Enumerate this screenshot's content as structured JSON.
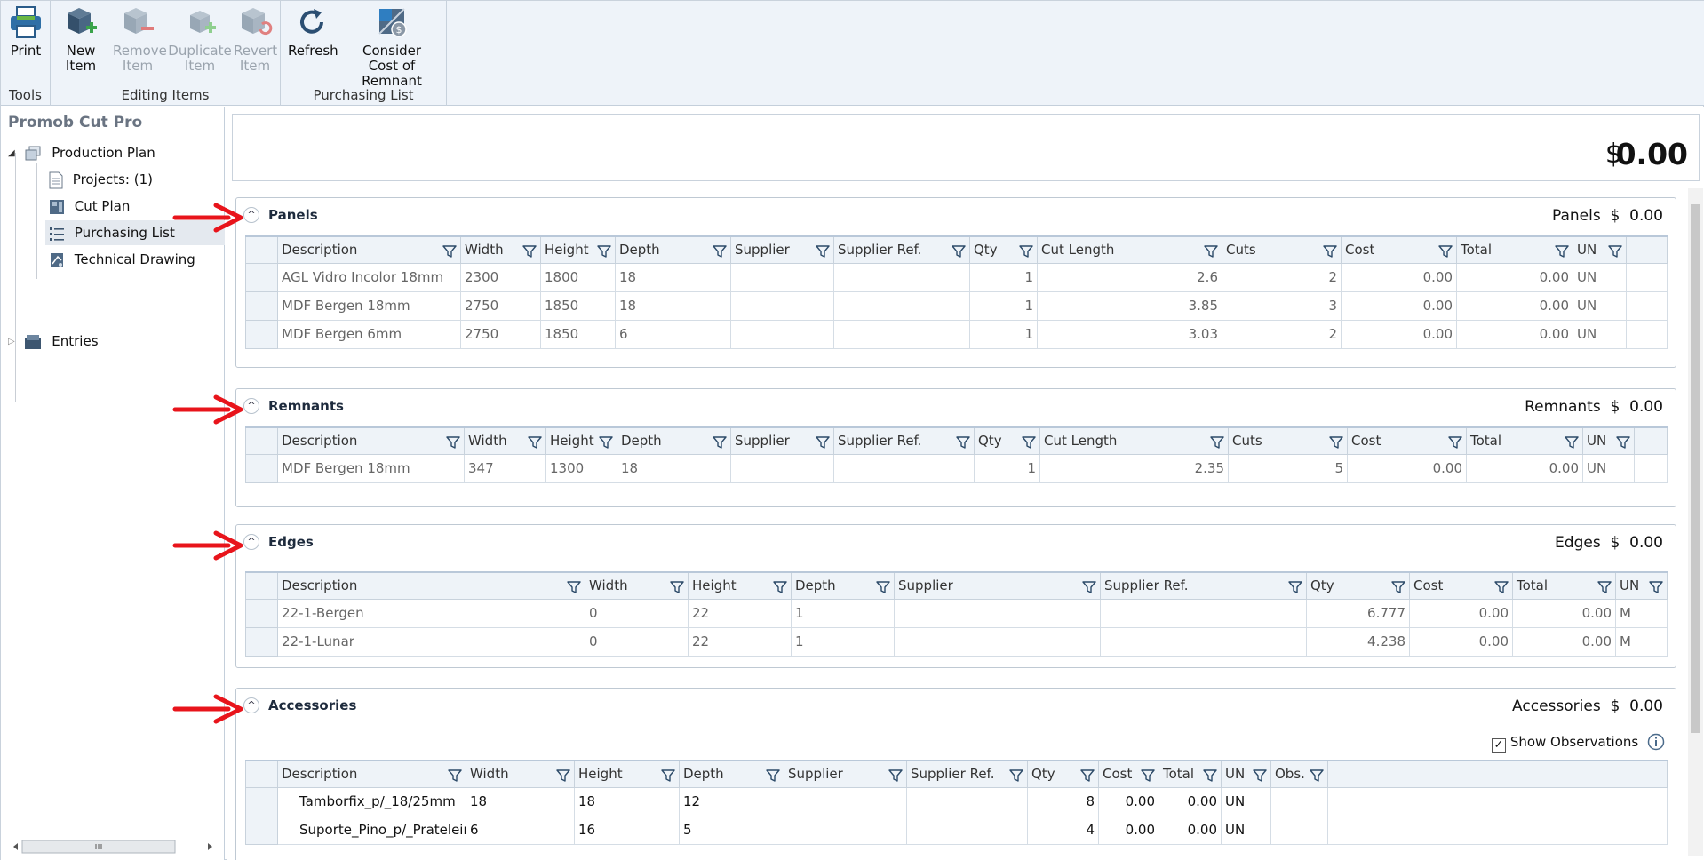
{
  "ribbon": {
    "groups": {
      "tools": "Tools",
      "editing": "Editing Items",
      "purchasing": "Purchasing List"
    },
    "buttons": {
      "print": "Print",
      "new_item": [
        "New",
        "Item"
      ],
      "remove_item": [
        "Remove",
        "Item"
      ],
      "duplicate_item": [
        "Duplicate",
        "Item"
      ],
      "revert_item": [
        "Revert",
        "Item"
      ],
      "refresh": "Refresh",
      "consider_cost": [
        "Consider",
        "Cost of Remnant"
      ]
    }
  },
  "side": {
    "title": "Promob Cut Pro",
    "tree": {
      "production_plan": "Production Plan",
      "projects": "Projects: (1)",
      "cut_plan": "Cut Plan",
      "purchasing_list": "Purchasing List",
      "technical_drawing": "Technical Drawing",
      "entries": "Entries"
    }
  },
  "total": {
    "currency": "$",
    "value": "0.00"
  },
  "panels": {
    "title": "Panels",
    "summary_label": "Panels",
    "summary_currency": "$",
    "summary_value": "0.00",
    "columns": [
      "Description",
      "Width",
      "Height",
      "Depth",
      "Supplier",
      "Supplier Ref.",
      "Qty",
      "Cut Length",
      "Cuts",
      "Cost",
      "Total",
      "UN"
    ],
    "rows": [
      [
        "AGL Vidro Incolor 18mm",
        "2300",
        "1800",
        "18",
        "",
        "",
        "1",
        "2.6",
        "2",
        "0.00",
        "0.00",
        "UN"
      ],
      [
        "MDF Bergen 18mm",
        "2750",
        "1850",
        "18",
        "",
        "",
        "1",
        "3.85",
        "3",
        "0.00",
        "0.00",
        "UN"
      ],
      [
        "MDF Bergen 6mm",
        "2750",
        "1850",
        "6",
        "",
        "",
        "1",
        "3.03",
        "2",
        "0.00",
        "0.00",
        "UN"
      ]
    ]
  },
  "remnants": {
    "title": "Remnants",
    "summary_label": "Remnants",
    "summary_currency": "$",
    "summary_value": "0.00",
    "columns": [
      "Description",
      "Width",
      "Height",
      "Depth",
      "Supplier",
      "Supplier Ref.",
      "Qty",
      "Cut Length",
      "Cuts",
      "Cost",
      "Total",
      "UN"
    ],
    "rows": [
      [
        "MDF Bergen 18mm",
        "347",
        "1300",
        "18",
        "",
        "",
        "1",
        "2.35",
        "5",
        "0.00",
        "0.00",
        "UN"
      ]
    ]
  },
  "edges": {
    "title": "Edges",
    "summary_label": "Edges",
    "summary_currency": "$",
    "summary_value": "0.00",
    "columns": [
      "Description",
      "Width",
      "Height",
      "Depth",
      "Supplier",
      "Supplier Ref.",
      "Qty",
      "Cost",
      "Total",
      "UN"
    ],
    "rows": [
      [
        "22-1-Bergen",
        "0",
        "22",
        "1",
        "",
        "",
        "6.777",
        "0.00",
        "0.00",
        "M"
      ],
      [
        "22-1-Lunar",
        "0",
        "22",
        "1",
        "",
        "",
        "4.238",
        "0.00",
        "0.00",
        "M"
      ]
    ]
  },
  "accessories": {
    "title": "Accessories",
    "summary_label": "Accessories",
    "summary_currency": "$",
    "summary_value": "0.00",
    "show_observations": "Show Observations",
    "columns": [
      "Description",
      "Width",
      "Height",
      "Depth",
      "Supplier",
      "Supplier Ref.",
      "Qty",
      "Cost",
      "Total",
      "UN",
      "Obs."
    ],
    "rows": [
      [
        "Tamborfix_p/_18/25mm",
        "18",
        "18",
        "12",
        "",
        "",
        "8",
        "0.00",
        "0.00",
        "UN",
        ""
      ],
      [
        "Suporte_Pino_p/_Prateleira",
        "6",
        "16",
        "5",
        "",
        "",
        "4",
        "0.00",
        "0.00",
        "UN",
        ""
      ]
    ]
  },
  "colors": {
    "arrow": "#e8141b",
    "ribbon_bg": "#eef3f9",
    "header_bg": "#eef3f8"
  }
}
